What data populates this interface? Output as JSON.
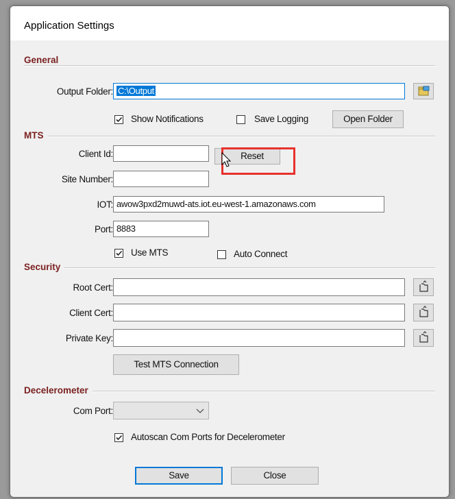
{
  "window": {
    "title": "Application Settings"
  },
  "general": {
    "section_label": "General",
    "output_folder_label": "Output Folder:",
    "output_folder_value": "C:\\Output",
    "show_notifications_label": "Show Notifications",
    "show_notifications_checked": true,
    "save_logging_label": "Save Logging",
    "save_logging_checked": false,
    "open_folder_label": "Open Folder"
  },
  "mts": {
    "section_label": "MTS",
    "client_id_label": "Client Id:",
    "client_id_value": "",
    "reset_label": "Reset",
    "site_number_label": "Site Number:",
    "site_number_value": "",
    "iot_label": "IOT:",
    "iot_value": "awow3pxd2muwd-ats.iot.eu-west-1.amazonaws.com",
    "port_label": "Port:",
    "port_value": "8883",
    "use_mts_label": "Use MTS",
    "use_mts_checked": true,
    "auto_connect_label": "Auto Connect",
    "auto_connect_checked": false
  },
  "security": {
    "section_label": "Security",
    "root_cert_label": "Root Cert:",
    "root_cert_value": "",
    "client_cert_label": "Client Cert:",
    "client_cert_value": "",
    "private_key_label": "Private Key:",
    "private_key_value": "",
    "test_connection_label": "Test MTS Connection"
  },
  "decelerometer": {
    "section_label": "Decelerometer",
    "com_port_label": "Com Port:",
    "com_port_value": "",
    "autoscan_label": "Autoscan Com Ports for Decelerometer",
    "autoscan_checked": true
  },
  "footer": {
    "save_label": "Save",
    "close_label": "Close"
  },
  "colors": {
    "section_text": "#7a1f1f",
    "accent": "#0078d7",
    "highlight": "#e8312d"
  }
}
